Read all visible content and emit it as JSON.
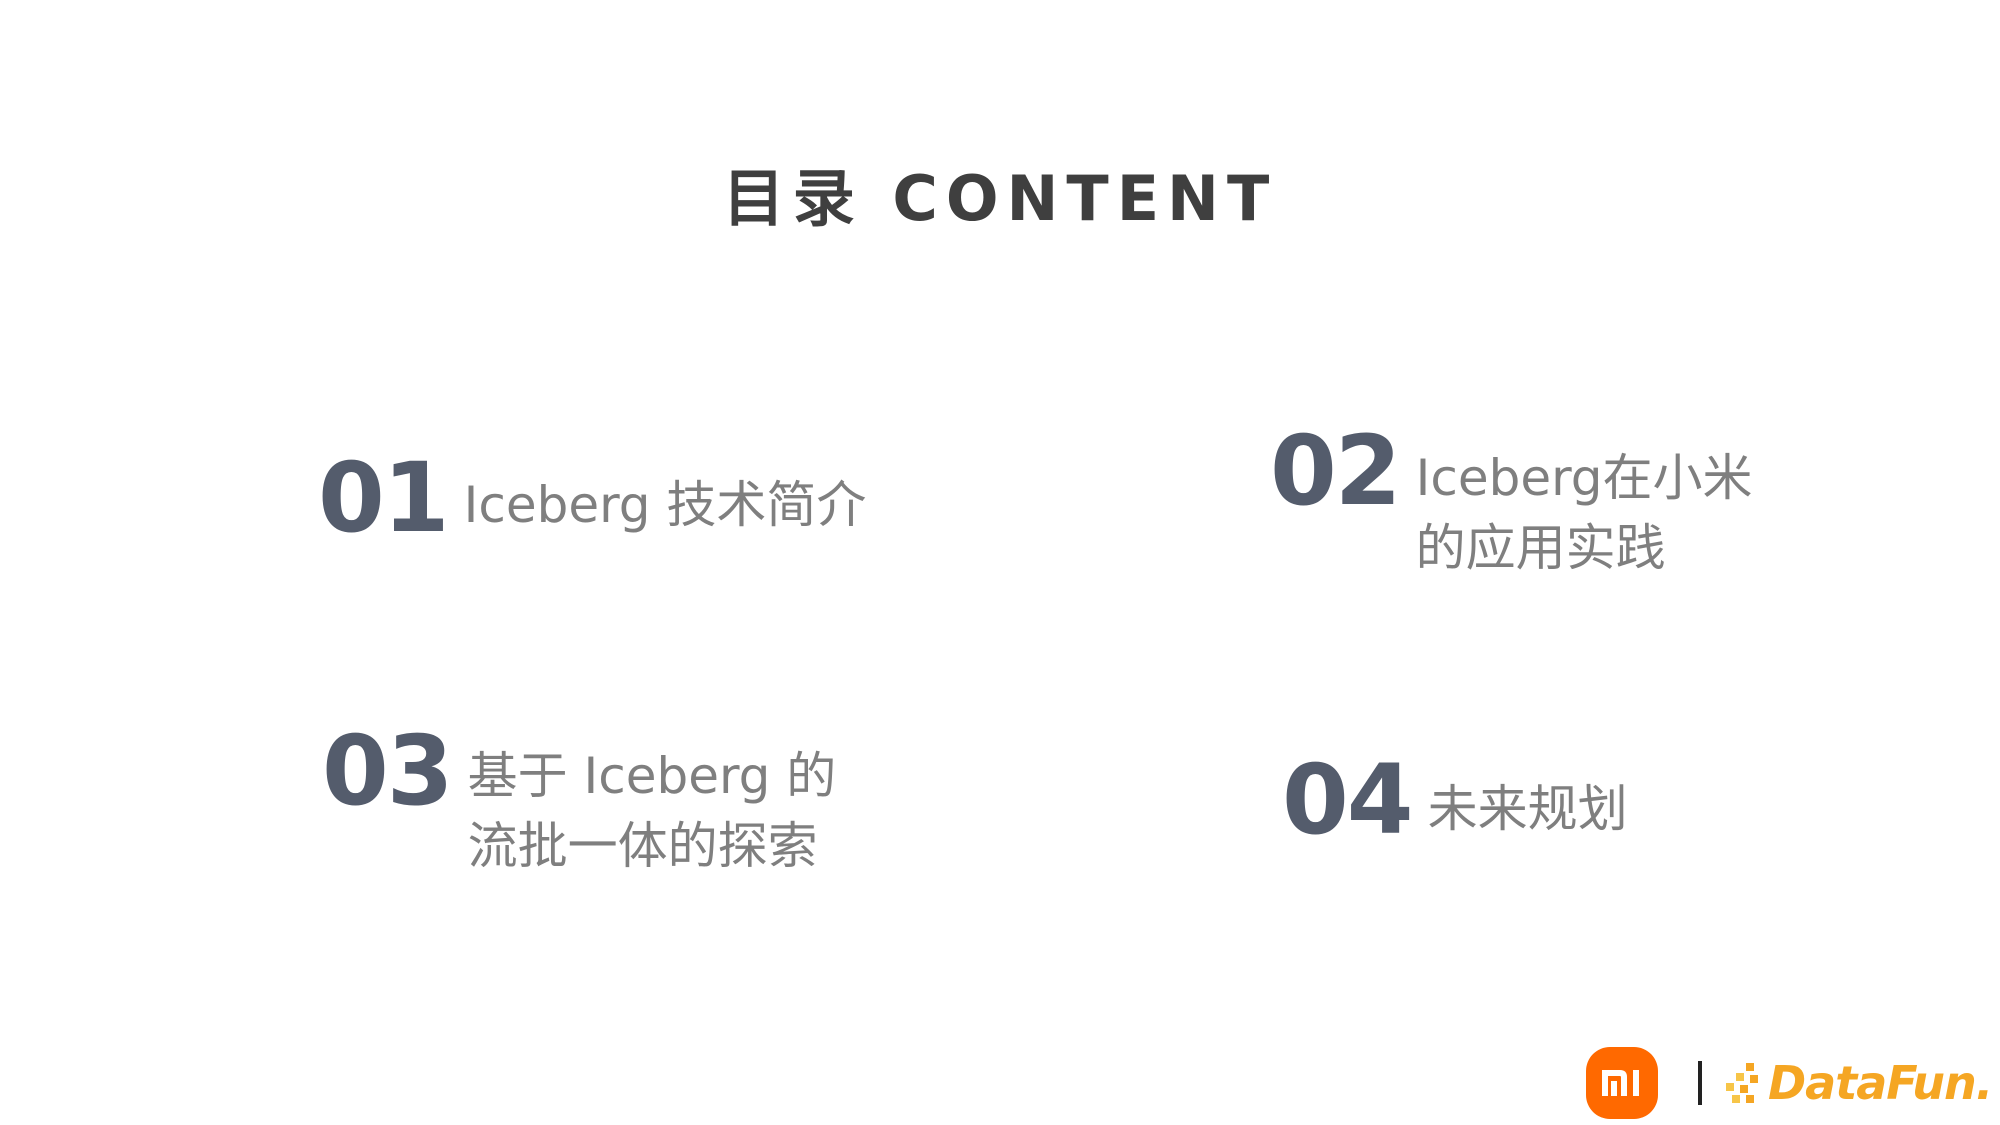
{
  "title": "目录 CONTENT",
  "items": [
    {
      "number": "01",
      "lines": [
        "Iceberg 技术简介"
      ]
    },
    {
      "number": "02",
      "lines": [
        "Iceberg在小米",
        "的应用实践"
      ]
    },
    {
      "number": "03",
      "lines": [
        "基于 Iceberg 的",
        "流批一体的探索"
      ]
    },
    {
      "number": "04",
      "lines": [
        "未来规划"
      ]
    }
  ],
  "footer": {
    "logos": [
      "xiaomi-logo",
      "datafun-logo"
    ],
    "mi_logo_text": "mi",
    "datafun_text": "DataFun."
  },
  "colors": {
    "title": "#3f3f3f",
    "number": "#545c6c",
    "label": "#7f7f7f",
    "xiaomi_orange": "#ff6900",
    "datafun_orange": "#f5a623"
  }
}
